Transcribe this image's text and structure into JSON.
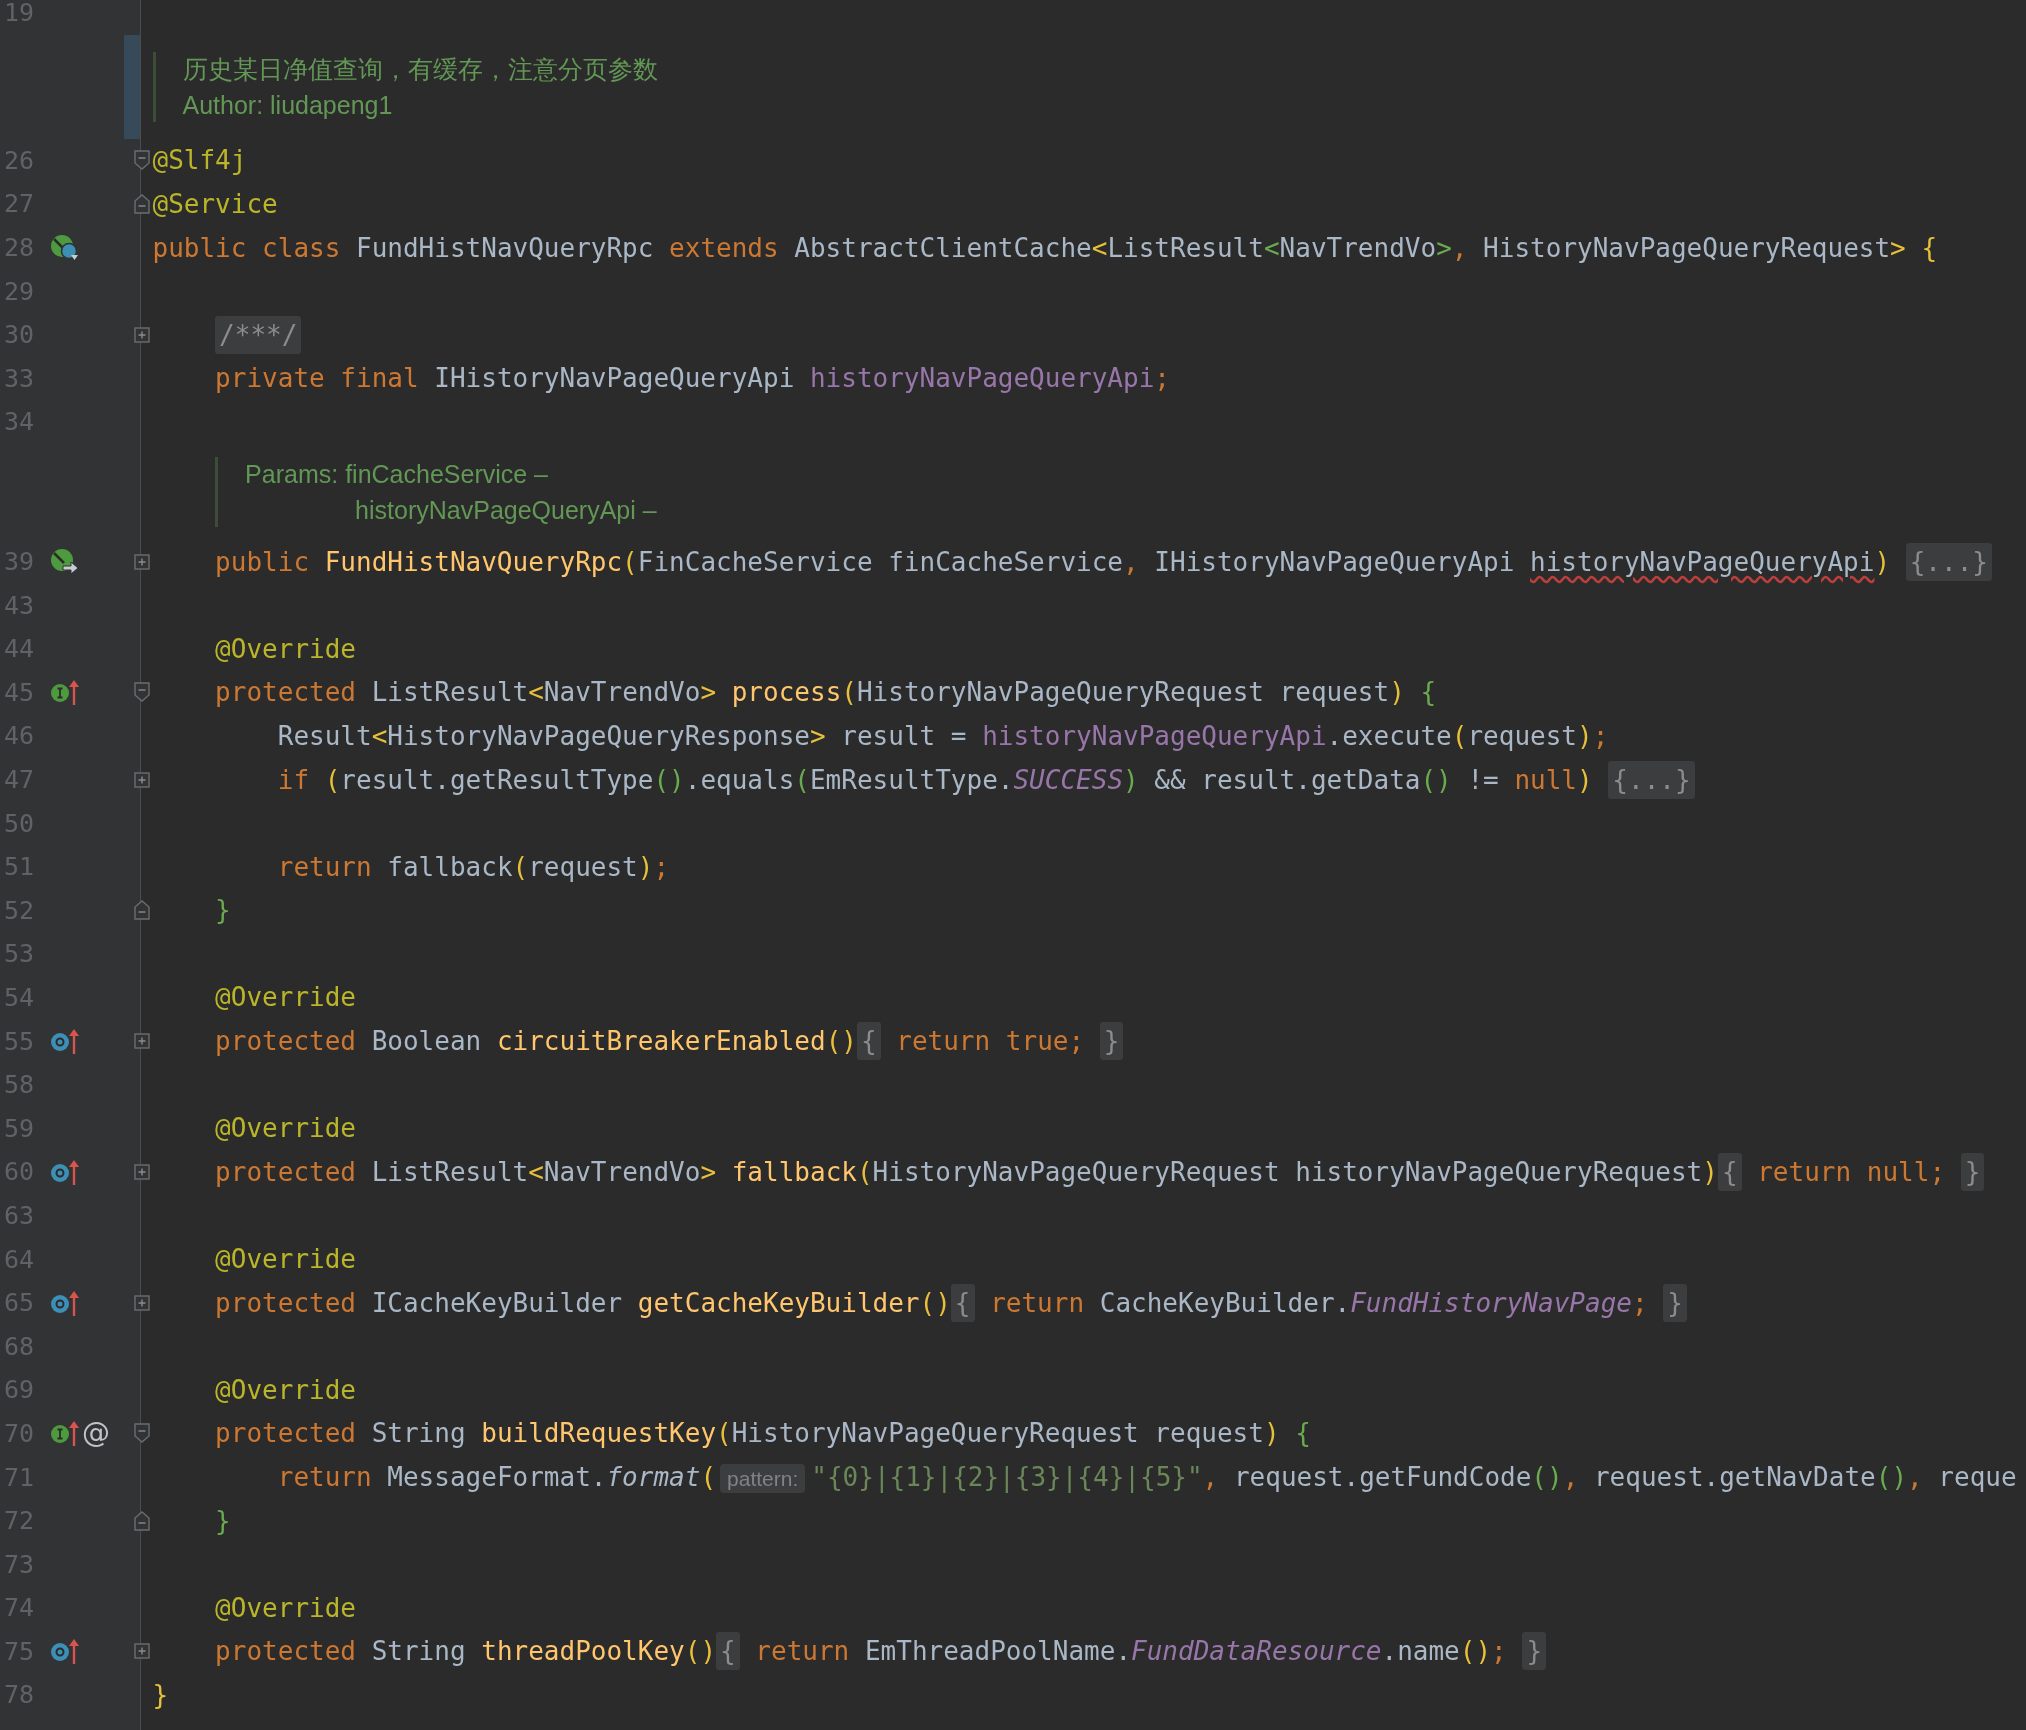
{
  "editor": {
    "rows": [
      {
        "kind": "code",
        "number": "19",
        "icons": [],
        "tokens": []
      },
      {
        "kind": "class-doc",
        "highlighted": true,
        "lines": [
          {
            "text": "历史某日净值查询，有缓存，注意分页参数",
            "hanging": false
          },
          {
            "text": "Author: liudapeng1",
            "hanging": false
          }
        ]
      },
      {
        "kind": "code",
        "number": "26",
        "icons": [],
        "fold": {
          "kind": "start"
        },
        "tokens": [
          {
            "kind": "annotation",
            "text": "@Slf4j"
          }
        ]
      },
      {
        "kind": "code",
        "number": "27",
        "icons": [],
        "fold": {
          "kind": "end"
        },
        "tokens": [
          {
            "kind": "annotation",
            "text": "@Service"
          }
        ]
      },
      {
        "kind": "code",
        "number": "28",
        "icons": [
          {
            "kind": "bean-class"
          }
        ],
        "tokens": [
          {
            "kind": "keyword",
            "text": "public class "
          },
          {
            "kind": "plain",
            "text": "FundHistNavQueryRpc"
          },
          {
            "kind": "keyword",
            "text": " extends "
          },
          {
            "kind": "plain",
            "text": "AbstractClientCache"
          },
          {
            "kind": "bracket",
            "text": "<"
          },
          {
            "kind": "plain",
            "text": "ListResult"
          },
          {
            "kind": "inner",
            "text": "<"
          },
          {
            "kind": "plain",
            "text": "NavTrendVo"
          },
          {
            "kind": "inner",
            "text": ">"
          },
          {
            "kind": "keyword",
            "text": ", "
          },
          {
            "kind": "plain",
            "text": "HistoryNavPageQueryRequest"
          },
          {
            "kind": "bracket",
            "text": "> {"
          }
        ]
      },
      {
        "kind": "code",
        "number": "29",
        "icons": [],
        "tokens": []
      },
      {
        "kind": "code",
        "number": "30",
        "icons": [],
        "fold": {
          "kind": "collapsed"
        },
        "tokens": [
          {
            "kind": "folded",
            "text": "/***/"
          }
        ]
      },
      {
        "kind": "code",
        "number": "33",
        "icons": [],
        "tokens": [
          {
            "kind": "keyword",
            "text": "    private final "
          },
          {
            "kind": "plain",
            "text": "IHistoryNavPageQueryApi "
          },
          {
            "kind": "field",
            "text": "historyNavPageQueryApi"
          },
          {
            "kind": "keyword",
            "text": ";"
          }
        ]
      },
      {
        "kind": "code",
        "number": "34",
        "icons": [],
        "tokens": []
      },
      {
        "kind": "member-doc",
        "highlighted": false,
        "lines": [
          {
            "text": "Params: finCacheService –",
            "hanging": false
          },
          {
            "text": "historyNavPageQueryApi –",
            "hanging": true
          }
        ]
      },
      {
        "kind": "code",
        "number": "39",
        "icons": [
          {
            "kind": "bean-constructor"
          }
        ],
        "fold": {
          "kind": "collapsed"
        },
        "tokens": [
          {
            "kind": "keyword",
            "text": "    public "
          },
          {
            "kind": "declaration",
            "text": "FundHistNavQueryRpc"
          },
          {
            "kind": "bracket",
            "text": "("
          },
          {
            "kind": "plain",
            "text": "FinCacheService finCacheService"
          },
          {
            "kind": "keyword",
            "text": ", "
          },
          {
            "kind": "plain",
            "text": "IHistoryNavPageQueryApi "
          },
          {
            "kind": "plain",
            "text": "historyNavPageQueryApi",
            "misspelled": true
          },
          {
            "kind": "bracket",
            "text": ") "
          },
          {
            "kind": "folded",
            "text": "{...}"
          }
        ]
      },
      {
        "kind": "code",
        "number": "43",
        "icons": [],
        "tokens": []
      },
      {
        "kind": "code",
        "number": "44",
        "icons": [],
        "tokens": [
          {
            "kind": "annotation",
            "text": "    @Override"
          }
        ]
      },
      {
        "kind": "code",
        "number": "45",
        "icons": [
          {
            "kind": "implementing"
          }
        ],
        "fold": {
          "kind": "start"
        },
        "tokens": [
          {
            "kind": "keyword",
            "text": "    protected "
          },
          {
            "kind": "plain",
            "text": "ListResult"
          },
          {
            "kind": "bracket",
            "text": "<"
          },
          {
            "kind": "plain",
            "text": "NavTrendVo"
          },
          {
            "kind": "bracket",
            "text": "> "
          },
          {
            "kind": "declaration",
            "text": "process"
          },
          {
            "kind": "bracket",
            "text": "("
          },
          {
            "kind": "plain",
            "text": "HistoryNavPageQueryRequest request"
          },
          {
            "kind": "bracket",
            "text": ") "
          },
          {
            "kind": "inner",
            "text": "{"
          }
        ]
      },
      {
        "kind": "code",
        "number": "46",
        "icons": [],
        "tokens": [
          {
            "kind": "plain",
            "text": "        Result"
          },
          {
            "kind": "bracket",
            "text": "<"
          },
          {
            "kind": "plain",
            "text": "HistoryNavPageQueryResponse"
          },
          {
            "kind": "bracket",
            "text": ">"
          },
          {
            "kind": "plain",
            "text": " result = "
          },
          {
            "kind": "field",
            "text": "historyNavPageQueryApi"
          },
          {
            "kind": "plain",
            "text": ".execute"
          },
          {
            "kind": "bracket",
            "text": "("
          },
          {
            "kind": "plain",
            "text": "request"
          },
          {
            "kind": "bracket",
            "text": ")"
          },
          {
            "kind": "keyword",
            "text": ";"
          }
        ]
      },
      {
        "kind": "code",
        "number": "47",
        "icons": [],
        "fold": {
          "kind": "collapsed"
        },
        "tokens": [
          {
            "kind": "keyword",
            "text": "        if "
          },
          {
            "kind": "bracket",
            "text": "("
          },
          {
            "kind": "plain",
            "text": "result.getResultType"
          },
          {
            "kind": "inner",
            "text": "()"
          },
          {
            "kind": "plain",
            "text": ".equals"
          },
          {
            "kind": "inner",
            "text": "("
          },
          {
            "kind": "plain",
            "text": "EmResultType."
          },
          {
            "kind": "constant",
            "text": "SUCCESS"
          },
          {
            "kind": "inner",
            "text": ")"
          },
          {
            "kind": "plain",
            "text": " && result.getData"
          },
          {
            "kind": "inner",
            "text": "()"
          },
          {
            "kind": "plain",
            "text": " != "
          },
          {
            "kind": "keyword",
            "text": "null"
          },
          {
            "kind": "bracket",
            "text": ") "
          },
          {
            "kind": "folded",
            "text": "{...}"
          }
        ]
      },
      {
        "kind": "code",
        "number": "50",
        "icons": [],
        "tokens": []
      },
      {
        "kind": "code",
        "number": "51",
        "icons": [],
        "tokens": [
          {
            "kind": "keyword",
            "text": "        return "
          },
          {
            "kind": "plain",
            "text": "fallback"
          },
          {
            "kind": "bracket",
            "text": "("
          },
          {
            "kind": "plain",
            "text": "request"
          },
          {
            "kind": "bracket",
            "text": ")"
          },
          {
            "kind": "keyword",
            "text": ";"
          }
        ]
      },
      {
        "kind": "code",
        "number": "52",
        "icons": [],
        "fold": {
          "kind": "end"
        },
        "tokens": [
          {
            "kind": "inner",
            "text": "    }"
          }
        ]
      },
      {
        "kind": "code",
        "number": "53",
        "icons": [],
        "tokens": []
      },
      {
        "kind": "code",
        "number": "54",
        "icons": [],
        "tokens": [
          {
            "kind": "annotation",
            "text": "    @Override"
          }
        ]
      },
      {
        "kind": "code",
        "number": "55",
        "icons": [
          {
            "kind": "overriding"
          }
        ],
        "fold": {
          "kind": "collapsed"
        },
        "tokens": [
          {
            "kind": "keyword",
            "text": "    protected "
          },
          {
            "kind": "plain",
            "text": "Boolean "
          },
          {
            "kind": "declaration",
            "text": "circuitBreakerEnabled"
          },
          {
            "kind": "bracket",
            "text": "()"
          },
          {
            "kind": "folded",
            "text": "{"
          },
          {
            "kind": "keyword",
            "text": " return true; "
          },
          {
            "kind": "folded",
            "text": "}"
          }
        ]
      },
      {
        "kind": "code",
        "number": "58",
        "icons": [],
        "tokens": []
      },
      {
        "kind": "code",
        "number": "59",
        "icons": [],
        "tokens": [
          {
            "kind": "annotation",
            "text": "    @Override"
          }
        ]
      },
      {
        "kind": "code",
        "number": "60",
        "icons": [
          {
            "kind": "overriding"
          }
        ],
        "fold": {
          "kind": "collapsed"
        },
        "tokens": [
          {
            "kind": "keyword",
            "text": "    protected "
          },
          {
            "kind": "plain",
            "text": "ListResult"
          },
          {
            "kind": "bracket",
            "text": "<"
          },
          {
            "kind": "plain",
            "text": "NavTrendVo"
          },
          {
            "kind": "bracket",
            "text": "> "
          },
          {
            "kind": "declaration",
            "text": "fallback"
          },
          {
            "kind": "bracket",
            "text": "("
          },
          {
            "kind": "plain",
            "text": "HistoryNavPageQueryRequest historyNavPageQueryRequest"
          },
          {
            "kind": "bracket",
            "text": ")"
          },
          {
            "kind": "folded",
            "text": "{"
          },
          {
            "kind": "keyword",
            "text": " return null; "
          },
          {
            "kind": "folded",
            "text": "}"
          }
        ]
      },
      {
        "kind": "code",
        "number": "63",
        "icons": [],
        "tokens": []
      },
      {
        "kind": "code",
        "number": "64",
        "icons": [],
        "tokens": [
          {
            "kind": "annotation",
            "text": "    @Override"
          }
        ]
      },
      {
        "kind": "code",
        "number": "65",
        "icons": [
          {
            "kind": "overriding"
          }
        ],
        "fold": {
          "kind": "collapsed"
        },
        "tokens": [
          {
            "kind": "keyword",
            "text": "    protected "
          },
          {
            "kind": "plain",
            "text": "ICacheKeyBuilder "
          },
          {
            "kind": "declaration",
            "text": "getCacheKeyBuilder"
          },
          {
            "kind": "bracket",
            "text": "()"
          },
          {
            "kind": "folded",
            "text": "{"
          },
          {
            "kind": "keyword",
            "text": " return "
          },
          {
            "kind": "plain",
            "text": "CacheKeyBuilder."
          },
          {
            "kind": "constant",
            "text": "FundHistoryNavPage"
          },
          {
            "kind": "keyword",
            "text": "; "
          },
          {
            "kind": "folded",
            "text": "}"
          }
        ]
      },
      {
        "kind": "code",
        "number": "68",
        "icons": [],
        "tokens": []
      },
      {
        "kind": "code",
        "number": "69",
        "icons": [],
        "tokens": [
          {
            "kind": "annotation",
            "text": "    @Override"
          }
        ]
      },
      {
        "kind": "code",
        "number": "70",
        "icons": [
          {
            "kind": "implementing"
          },
          {
            "kind": "symbol",
            "text": "@"
          }
        ],
        "fold": {
          "kind": "start"
        },
        "tokens": [
          {
            "kind": "keyword",
            "text": "    protected "
          },
          {
            "kind": "plain",
            "text": "String "
          },
          {
            "kind": "declaration",
            "text": "buildRequestKey"
          },
          {
            "kind": "bracket",
            "text": "("
          },
          {
            "kind": "plain",
            "text": "HistoryNavPageQueryRequest request"
          },
          {
            "kind": "bracket",
            "text": ") "
          },
          {
            "kind": "inner",
            "text": "{"
          }
        ]
      },
      {
        "kind": "code",
        "number": "71",
        "icons": [],
        "tokens": [
          {
            "kind": "keyword",
            "text": "        return "
          },
          {
            "kind": "plain",
            "text": "MessageFormat."
          },
          {
            "kind": "italic",
            "text": "format"
          },
          {
            "kind": "bracket",
            "text": "("
          },
          {
            "kind": "hint",
            "text": "pattern:"
          },
          {
            "kind": "string",
            "text": "\"{0}|{1}|{2}|{3}|{4}|{5}\""
          },
          {
            "kind": "keyword",
            "text": ", "
          },
          {
            "kind": "plain",
            "text": "request.getFundCode"
          },
          {
            "kind": "inner",
            "text": "()"
          },
          {
            "kind": "keyword",
            "text": ", "
          },
          {
            "kind": "plain",
            "text": "request.getNavDate"
          },
          {
            "kind": "inner",
            "text": "()"
          },
          {
            "kind": "keyword",
            "text": ", "
          },
          {
            "kind": "plain",
            "text": "reque"
          }
        ]
      },
      {
        "kind": "code",
        "number": "72",
        "icons": [],
        "fold": {
          "kind": "end"
        },
        "tokens": [
          {
            "kind": "inner",
            "text": "    }"
          }
        ]
      },
      {
        "kind": "code",
        "number": "73",
        "icons": [],
        "tokens": []
      },
      {
        "kind": "code",
        "number": "74",
        "icons": [],
        "tokens": [
          {
            "kind": "annotation",
            "text": "    @Override"
          }
        ]
      },
      {
        "kind": "code",
        "number": "75",
        "icons": [
          {
            "kind": "overriding"
          }
        ],
        "fold": {
          "kind": "collapsed"
        },
        "tokens": [
          {
            "kind": "keyword",
            "text": "    protected "
          },
          {
            "kind": "plain",
            "text": "String "
          },
          {
            "kind": "declaration",
            "text": "threadPoolKey"
          },
          {
            "kind": "bracket",
            "text": "()"
          },
          {
            "kind": "folded",
            "text": "{"
          },
          {
            "kind": "keyword",
            "text": " return "
          },
          {
            "kind": "plain",
            "text": "EmThreadPoolName."
          },
          {
            "kind": "constant",
            "text": "FundDataResource"
          },
          {
            "kind": "plain",
            "text": ".name"
          },
          {
            "kind": "bracket",
            "text": "()"
          },
          {
            "kind": "keyword",
            "text": "; "
          },
          {
            "kind": "folded",
            "text": "}"
          }
        ]
      },
      {
        "kind": "code",
        "number": "78",
        "icons": [],
        "tokens": [
          {
            "kind": "bracket",
            "text": "}"
          }
        ]
      }
    ]
  }
}
